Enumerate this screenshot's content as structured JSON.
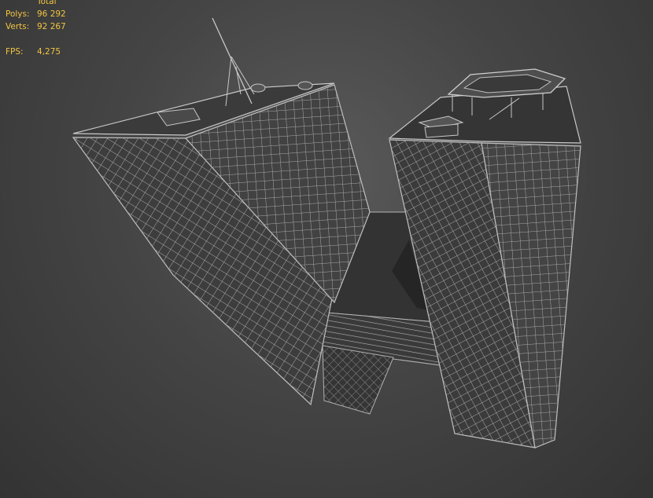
{
  "stats": {
    "header": "Total",
    "polys_label": "Polys:",
    "polys_value": "96 292",
    "verts_label": "Verts:",
    "verts_value": "92 267",
    "fps_label": "FPS:",
    "fps_value": "4,275"
  },
  "colors": {
    "stats_text": "#f2c440",
    "wire": "#bdbdbd",
    "face_dark": "#2b2b2b",
    "face_mid": "#3a3a3a"
  }
}
